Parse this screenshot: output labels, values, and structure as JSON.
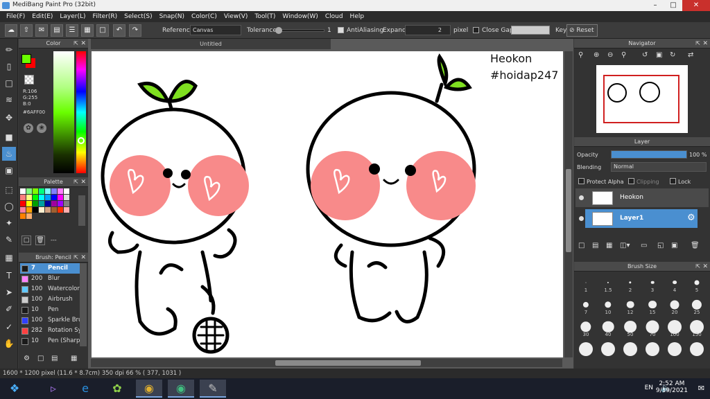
{
  "window": {
    "title": "MediBang Paint Pro (32bit)"
  },
  "menu": [
    "File(F)",
    "Edit(E)",
    "Layer(L)",
    "Filter(R)",
    "Select(S)",
    "Snap(N)",
    "Color(C)",
    "View(V)",
    "Tool(T)",
    "Window(W)",
    "Cloud",
    "Help"
  ],
  "toolbar": {
    "reference_label": "Reference",
    "reference_value": "Canvas",
    "tolerance_label": "Tolerance",
    "tolerance_value": "1",
    "antialiasing_label": "AntiAliasing",
    "expand_label": "Expand",
    "expand_value": "2",
    "expand_unit": "pixel",
    "close_gaps_label": "Close Gaps",
    "key_label": "Key",
    "reset_label": "Reset"
  },
  "color_panel": {
    "title": "Color",
    "r": "R:106",
    "g": "G:255",
    "b": "B:0",
    "hex": "#6AFF00",
    "primary_color": "#6aff00",
    "secondary_color": "#ff0000"
  },
  "palette_panel": {
    "title": "Palette",
    "footer_text": "---",
    "swatches": [
      "#ffffff",
      "#7fff7f",
      "#7fff00",
      "#00ff7f",
      "#7fffff",
      "#7f7fff",
      "#ff7fff",
      "#ffffff",
      "#ff7f7f",
      "#ffff7f",
      "#00ff00",
      "#00ffff",
      "#00a0ff",
      "#0000ff",
      "#ff00ff",
      "#dddddd",
      "#ff0000",
      "#ffff00",
      "#00a000",
      "#00a0a0",
      "#0000a0",
      "#a000a0",
      "#a000ff",
      "#808080",
      "#ff7fa0",
      "#ffa000",
      "#000000",
      "#fff0d0",
      "#d0a080",
      "#a06030",
      "#ff3000",
      "#ffb0b0",
      "#ff8000",
      "#ffb070"
    ]
  },
  "brush_panel": {
    "title": "Brush: Pencil",
    "items": [
      {
        "size": "7",
        "name": "Pencil",
        "color": "#1a1a1a"
      },
      {
        "size": "200",
        "name": "Blur",
        "color": "#ff80ff"
      },
      {
        "size": "100",
        "name": "Watercolor",
        "color": "#60c8ff"
      },
      {
        "size": "100",
        "name": "Airbrush",
        "color": "#cccccc"
      },
      {
        "size": "10",
        "name": "Pen",
        "color": "#1a1a1a"
      },
      {
        "size": "100",
        "name": "Sparkle Brush",
        "color": "#3040ff"
      },
      {
        "size": "282",
        "name": "Rotation Symmetry",
        "color": "#ff4040"
      },
      {
        "size": "10",
        "name": "Pen (Sharp)",
        "color": "#1a1a1a"
      }
    ]
  },
  "canvas": {
    "tab_title": "Untitled",
    "text_line1": "Heokon",
    "text_line2": "#hoidap247"
  },
  "navigator": {
    "title": "Navigator"
  },
  "layer_panel": {
    "title": "Layer",
    "opacity_label": "Opacity",
    "opacity_value": "100 %",
    "opacity_fraction": 1.0,
    "blending_label": "Blending",
    "blending_value": "Normal",
    "protect_alpha_label": "Protect Alpha",
    "clipping_label": "Clipping",
    "lock_label": "Lock",
    "layers": [
      {
        "name": "Heokon",
        "active": false
      },
      {
        "name": "Layer1",
        "active": true
      }
    ]
  },
  "brush_size_panel": {
    "title": "Brush Size",
    "sizes": [
      "1",
      "1.5",
      "2",
      "3",
      "4",
      "5",
      "7",
      "10",
      "12",
      "15",
      "20",
      "25",
      "30",
      "40",
      "50",
      "70",
      "100",
      "150",
      "",
      "",
      "",
      "",
      "",
      ""
    ]
  },
  "status": {
    "text": "1600 * 1200 pixel   (11.6 * 8.7cm)   350 dpi   66 %   ( 377, 1031 )"
  },
  "taskbar": {
    "lang": "EN",
    "time": "2:52 AM",
    "date": "9/19/2021"
  }
}
